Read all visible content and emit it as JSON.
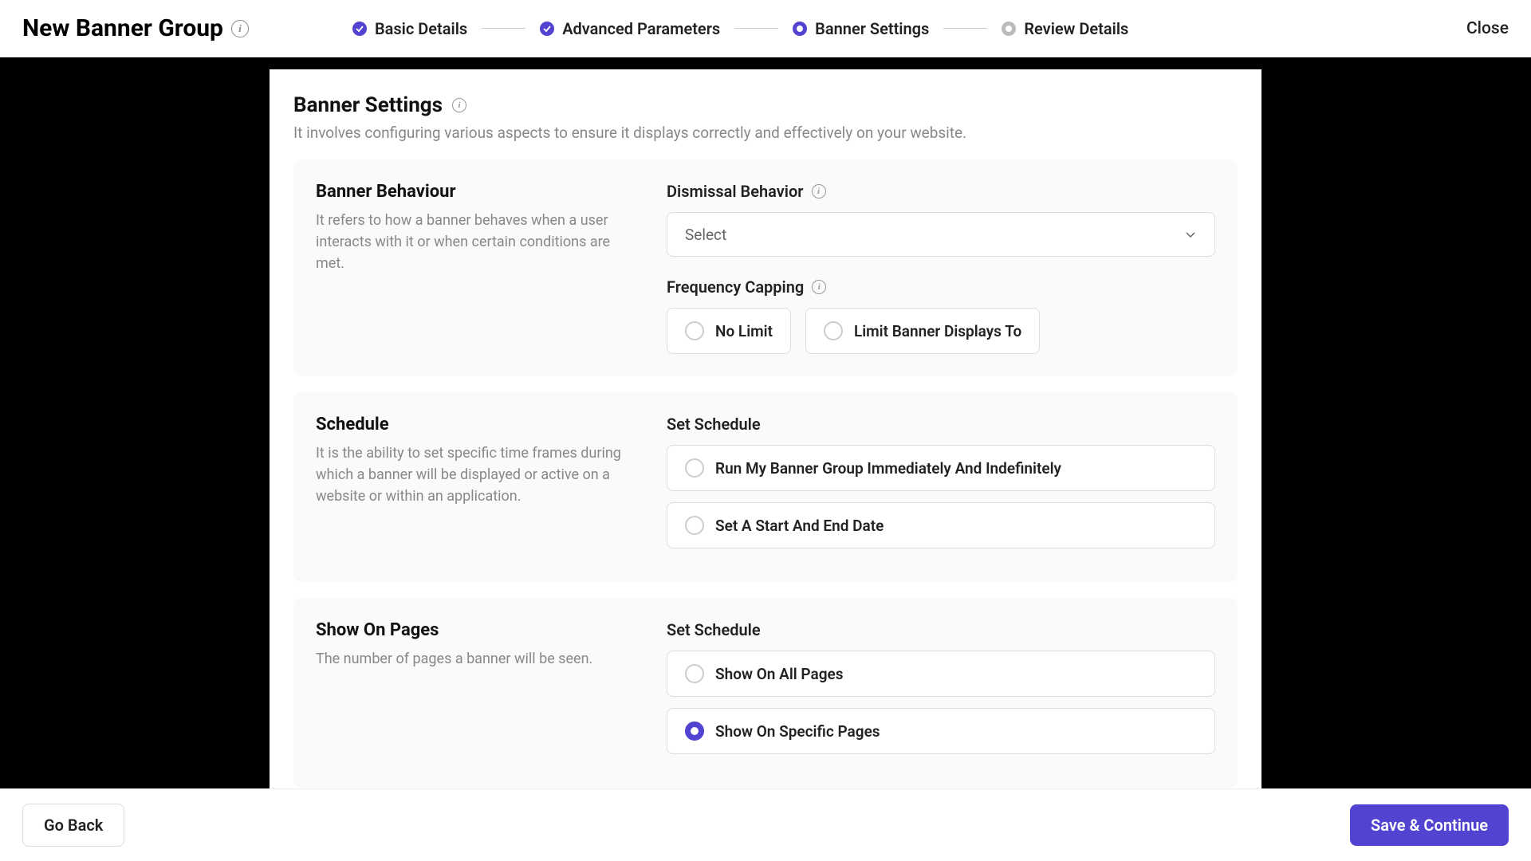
{
  "header": {
    "title": "New Banner Group",
    "close": "Close"
  },
  "stepper": {
    "step1": "Basic Details",
    "step2": "Advanced Parameters",
    "step3": "Banner Settings",
    "step4": "Review Details"
  },
  "main": {
    "title": "Banner Settings",
    "subtitle": "It involves configuring various aspects to ensure it displays correctly and effectively on your website."
  },
  "behaviour": {
    "title": "Banner Behaviour",
    "desc": "It refers to how a banner behaves when a user interacts with it or when certain conditions are met.",
    "dismissal_label": "Dismissal Behavior",
    "dismissal_placeholder": "Select",
    "freq_label": "Frequency Capping",
    "no_limit": "No Limit",
    "limit_to": "Limit Banner Displays To"
  },
  "schedule": {
    "title": "Schedule",
    "desc": "It is the ability to set specific time frames during which a banner will be displayed or active on a website or within an application.",
    "set_label": "Set Schedule",
    "opt1": "Run My Banner Group Immediately And Indefinitely",
    "opt2": "Set A Start And End Date"
  },
  "pages": {
    "title": "Show On Pages",
    "desc": "The number of pages a banner will be seen.",
    "set_label": "Set Schedule",
    "opt1": "Show On All Pages",
    "opt2": "Show On Specific Pages"
  },
  "footer": {
    "back": "Go Back",
    "save": "Save & Continue"
  }
}
